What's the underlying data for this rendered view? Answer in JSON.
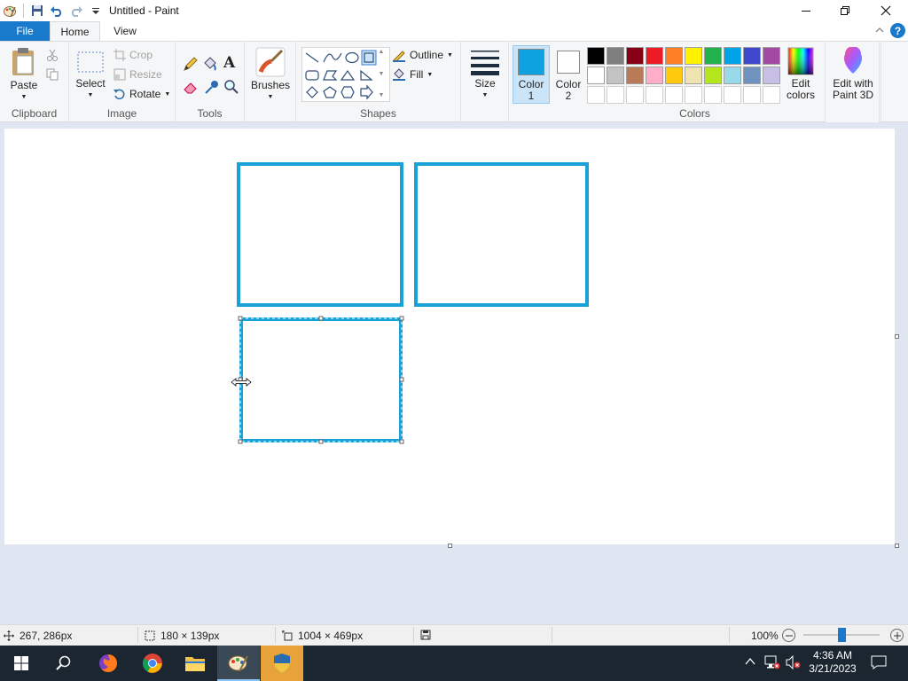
{
  "window": {
    "title": "Untitled - Paint"
  },
  "tabs": {
    "file": "File",
    "home": "Home",
    "view": "View"
  },
  "ribbon": {
    "clipboard": {
      "label": "Clipboard",
      "paste": "Paste"
    },
    "image": {
      "label": "Image",
      "select": "Select",
      "crop": "Crop",
      "resize": "Resize",
      "rotate": "Rotate"
    },
    "tools": {
      "label": "Tools"
    },
    "brushes": {
      "label": "Brushes"
    },
    "shapes": {
      "label": "Shapes",
      "outline": "Outline",
      "fill": "Fill"
    },
    "size": {
      "label": "Size"
    },
    "colors": {
      "label": "Colors",
      "color1_l1": "Color",
      "color1_l2": "1",
      "color2_l1": "Color",
      "color2_l2": "2",
      "color1_value": "#0ea3e0",
      "color2_value": "#ffffff",
      "edit_l1": "Edit",
      "edit_l2": "colors",
      "palette_row1": [
        "#000000",
        "#7f7f7f",
        "#880015",
        "#ed1c24",
        "#ff7f27",
        "#fff200",
        "#22b14c",
        "#00a2e8",
        "#3f48cc",
        "#a349a4"
      ],
      "palette_row2": [
        "#ffffff",
        "#c3c3c3",
        "#b97a57",
        "#ffaec9",
        "#ffc90e",
        "#efe4b0",
        "#b5e61d",
        "#99d9ea",
        "#7092be",
        "#c8bfe7"
      ]
    },
    "paint3d": {
      "l1": "Edit with",
      "l2": "Paint 3D"
    }
  },
  "status": {
    "cursor_pos": "267, 286px",
    "selection_size": "180 × 139px",
    "canvas_size": "1004 × 469px",
    "zoom": "100%",
    "zoom_level": 0.5
  },
  "taskbar": {
    "time": "4:36 AM",
    "date": "3/21/2023"
  },
  "accent_color": "#1979ca",
  "shape_stroke_color": "#1aa2d8"
}
